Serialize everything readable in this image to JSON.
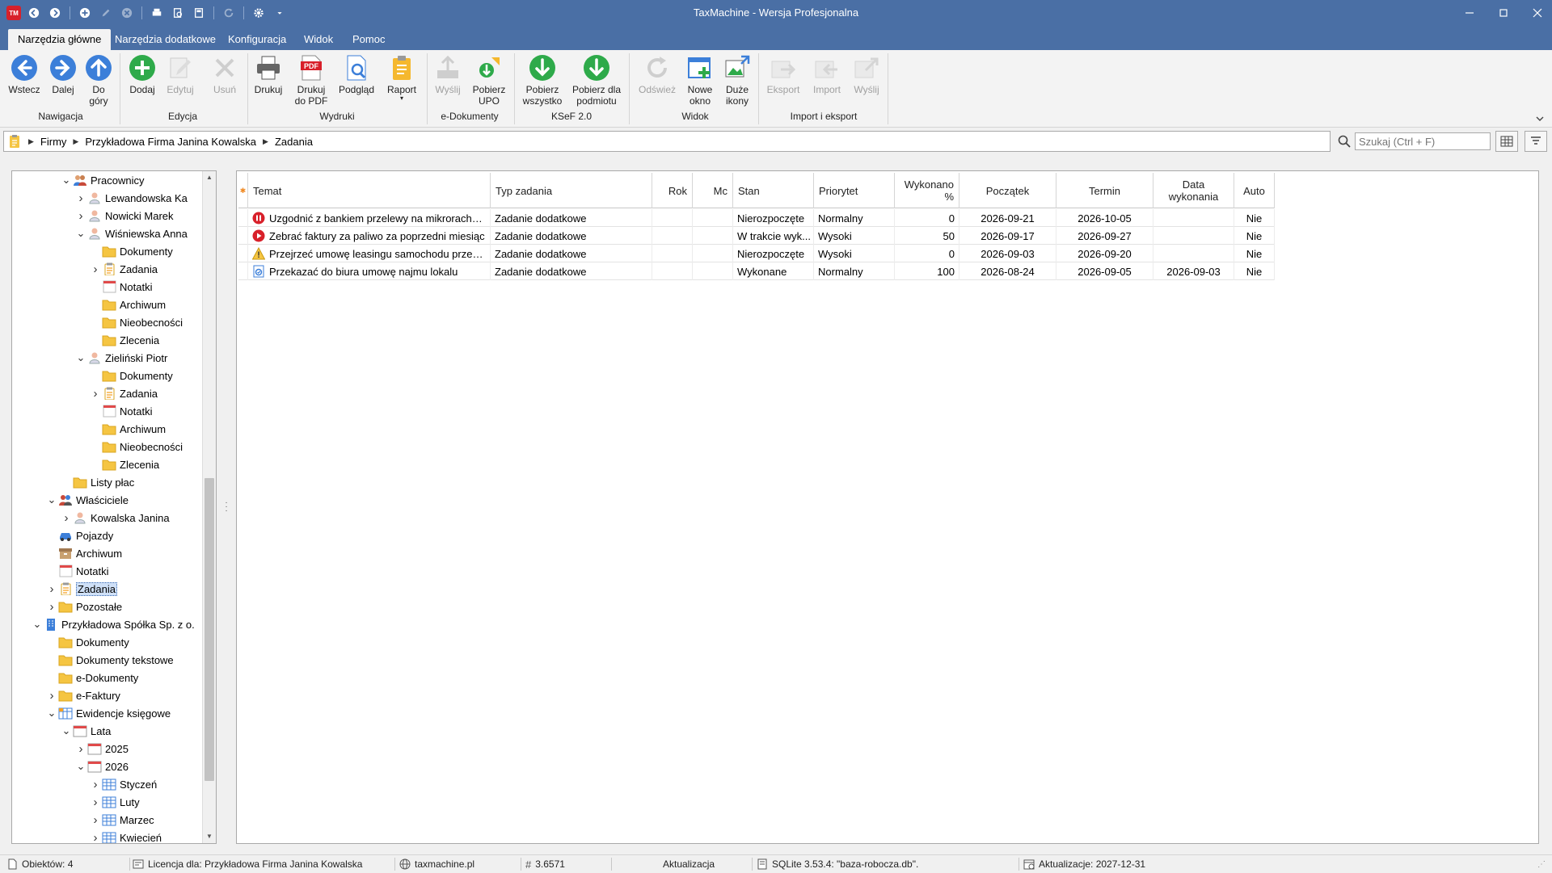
{
  "window": {
    "app_logo_text": "TM",
    "title": "TaxMachine  -  Wersja Profesjonalna"
  },
  "ribbon_tabs": [
    {
      "label": "Narzędzia główne",
      "active": true
    },
    {
      "label": "Narzędzia dodatkowe",
      "active": false
    },
    {
      "label": "Konfiguracja",
      "active": false
    },
    {
      "label": "Widok",
      "active": false
    },
    {
      "label": "Pomoc",
      "active": false
    }
  ],
  "ribbon": {
    "buttons": {
      "back": "Wstecz",
      "forward": "Dalej",
      "up": "Do\ngóry",
      "add": "Dodaj",
      "edit": "Edytuj",
      "delete": "Usuń",
      "print": "Drukuj",
      "print_pdf": "Drukuj\ndo PDF",
      "preview": "Podgląd",
      "report": "Raport",
      "send": "Wyślij",
      "fetch_upo": "Pobierz\nUPO",
      "fetch_all": "Pobierz\nwszystko",
      "fetch_entity": "Pobierz dla\npodmiotu",
      "refresh": "Odśwież",
      "new_window": "Nowe\nokno",
      "large_icons": "Duże\nikony",
      "export": "Eksport",
      "import": "Import",
      "send2": "Wyślij"
    },
    "pdf_badge": "PDF",
    "groups": {
      "nav": "Nawigacja",
      "edit": "Edycja",
      "prints": "Wydruki",
      "edocs": "e-Dokumenty",
      "ksef": "KSeF 2.0",
      "view": "Widok",
      "impexp": "Import i eksport"
    }
  },
  "address": {
    "crumbs": [
      "Firmy",
      "Przykładowa Firma Janina Kowalska",
      "Zadania"
    ],
    "search_placeholder": "Szukaj (Ctrl + F)"
  },
  "tree": {
    "items": [
      {
        "label": "Pracownicy",
        "icon": "people-icon",
        "exp": "open"
      },
      {
        "label": "Lewandowska Ka",
        "icon": "person-icon",
        "exp": "closed"
      },
      {
        "label": "Nowicki Marek",
        "icon": "person-icon",
        "exp": "closed"
      },
      {
        "label": "Wiśniewska Anna",
        "icon": "person-icon",
        "exp": "open"
      },
      {
        "label": "Dokumenty",
        "icon": "folder-icon",
        "exp": ""
      },
      {
        "label": "Zadania",
        "icon": "clipboard-icon",
        "exp": "closed"
      },
      {
        "label": "Notatki",
        "icon": "notepad-icon",
        "exp": ""
      },
      {
        "label": "Archiwum",
        "icon": "folder-icon",
        "exp": ""
      },
      {
        "label": "Nieobecności",
        "icon": "folder-icon",
        "exp": ""
      },
      {
        "label": "Zlecenia",
        "icon": "folder-icon",
        "exp": ""
      },
      {
        "label": "Zieliński Piotr",
        "icon": "person-icon",
        "exp": "open"
      },
      {
        "label": "Dokumenty",
        "icon": "folder-icon",
        "exp": ""
      },
      {
        "label": "Zadania",
        "icon": "clipboard-icon",
        "exp": "closed"
      },
      {
        "label": "Notatki",
        "icon": "notepad-icon",
        "exp": ""
      },
      {
        "label": "Archiwum",
        "icon": "folder-icon",
        "exp": ""
      },
      {
        "label": "Nieobecności",
        "icon": "folder-icon",
        "exp": ""
      },
      {
        "label": "Zlecenia",
        "icon": "folder-icon",
        "exp": ""
      },
      {
        "label": "Listy płac",
        "icon": "folder-icon",
        "exp": ""
      },
      {
        "label": "Właściciele",
        "icon": "owners-icon",
        "exp": "open"
      },
      {
        "label": "Kowalska Janina",
        "icon": "person-icon",
        "exp": "closed"
      },
      {
        "label": "Pojazdy",
        "icon": "car-icon",
        "exp": ""
      },
      {
        "label": "Archiwum",
        "icon": "archive-icon",
        "exp": ""
      },
      {
        "label": "Notatki",
        "icon": "notepad-icon",
        "exp": ""
      },
      {
        "label": "Zadania",
        "icon": "clipboard-icon",
        "exp": "closed",
        "selected": true
      },
      {
        "label": "Pozostałe",
        "icon": "folder-icon",
        "exp": "closed"
      },
      {
        "label": "Przykładowa Spółka Sp. z o.",
        "icon": "building-icon",
        "exp": "open"
      },
      {
        "label": "Dokumenty",
        "icon": "folder-icon",
        "exp": ""
      },
      {
        "label": "Dokumenty tekstowe",
        "icon": "folder-icon",
        "exp": ""
      },
      {
        "label": "e-Dokumenty",
        "icon": "folder-icon",
        "exp": ""
      },
      {
        "label": "e-Faktury",
        "icon": "folder-icon",
        "exp": "closed"
      },
      {
        "label": "Ewidencje księgowe",
        "icon": "ledger-icon",
        "exp": "open"
      },
      {
        "label": "Lata",
        "icon": "calendar-icon",
        "exp": "open"
      },
      {
        "label": "2025",
        "icon": "calendar-icon",
        "exp": "closed"
      },
      {
        "label": "2026",
        "icon": "calendar-icon",
        "exp": "open"
      },
      {
        "label": "Styczeń",
        "icon": "grid-icon",
        "exp": "closed"
      },
      {
        "label": "Luty",
        "icon": "grid-icon",
        "exp": "closed"
      },
      {
        "label": "Marzec",
        "icon": "grid-icon",
        "exp": "closed"
      },
      {
        "label": "Kwiecień",
        "icon": "grid-icon",
        "exp": "closed"
      }
    ]
  },
  "grid": {
    "columns": [
      "Temat",
      "Typ zadania",
      "Rok",
      "Mc",
      "Stan",
      "Priorytet",
      "Wykonano\n%",
      "Początek",
      "Termin",
      "Data\nwykonania",
      "Auto"
    ],
    "rows": [
      {
        "icon": "pause-icon",
        "cells": [
          "Uzgodnić z bankiem przelewy na mikrorachun...",
          "Zadanie dodatkowe",
          "",
          "",
          "Nierozpoczęte",
          "Normalny",
          "0",
          "2026-09-21",
          "2026-10-05",
          "",
          "Nie"
        ]
      },
      {
        "icon": "play-icon",
        "cells": [
          "Zebrać faktury za paliwo za poprzedni miesiąc",
          "Zadanie dodatkowe",
          "",
          "",
          "W trakcie wyk...",
          "Wysoki",
          "50",
          "2026-09-17",
          "2026-09-27",
          "",
          "Nie"
        ]
      },
      {
        "icon": "warning-icon",
        "cells": [
          "Przejrzeć umowę leasingu samochodu przed ...",
          "Zadanie dodatkowe",
          "",
          "",
          "Nierozpoczęte",
          "Wysoki",
          "0",
          "2026-09-03",
          "2026-09-20",
          "",
          "Nie"
        ]
      },
      {
        "icon": "done-icon",
        "cells": [
          "Przekazać do biura umowę najmu lokalu",
          "Zadanie dodatkowe",
          "",
          "",
          "Wykonane",
          "Normalny",
          "100",
          "2026-08-24",
          "2026-09-05",
          "2026-09-03",
          "Nie"
        ]
      }
    ]
  },
  "status": {
    "objects": "Obiektów: 4",
    "license": "Licencja dla: Przykładowa Firma Janina Kowalska",
    "website": "taxmachine.pl",
    "version": "3.6571",
    "update": "Aktualizacja",
    "db": "SQLite 3.53.4: \"baza-robocza.db\".",
    "updates_until": "Aktualizacje: 2027-12-31"
  },
  "colors": {
    "titlebar": "#4a6fa5",
    "green_btn": "#2eaa4a",
    "blue_btn": "#3c7fd9",
    "folder": "#f5c542",
    "selection": "#cfe0f7"
  }
}
